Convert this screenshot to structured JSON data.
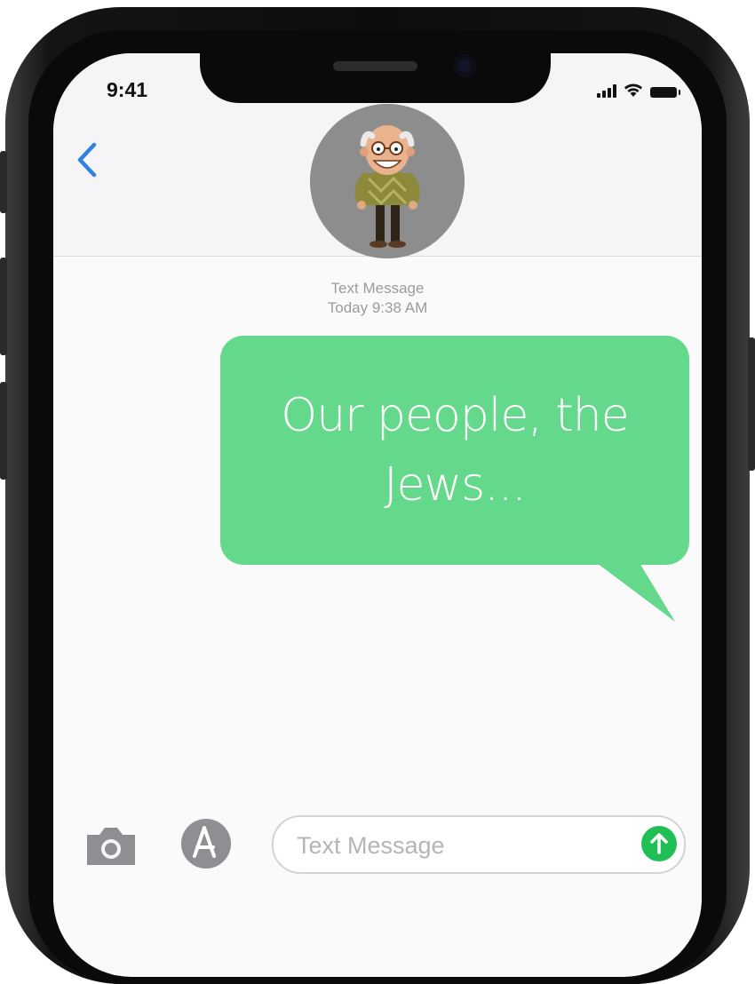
{
  "status_bar": {
    "time": "9:41"
  },
  "conversation": {
    "meta_label": "Text Message",
    "meta_time": "Today 9:38 AM"
  },
  "message": {
    "text": "Our people, the Jews...",
    "bubble_color": "#65d98b"
  },
  "input_bar": {
    "placeholder": "Text Message",
    "camera_icon": "camera-icon",
    "apps_icon": "app-store-icon",
    "send_icon": "send-arrow-icon",
    "send_color": "#1fbf55"
  },
  "nav": {
    "back_icon": "chevron-left-icon",
    "back_color": "#2f80e0"
  }
}
